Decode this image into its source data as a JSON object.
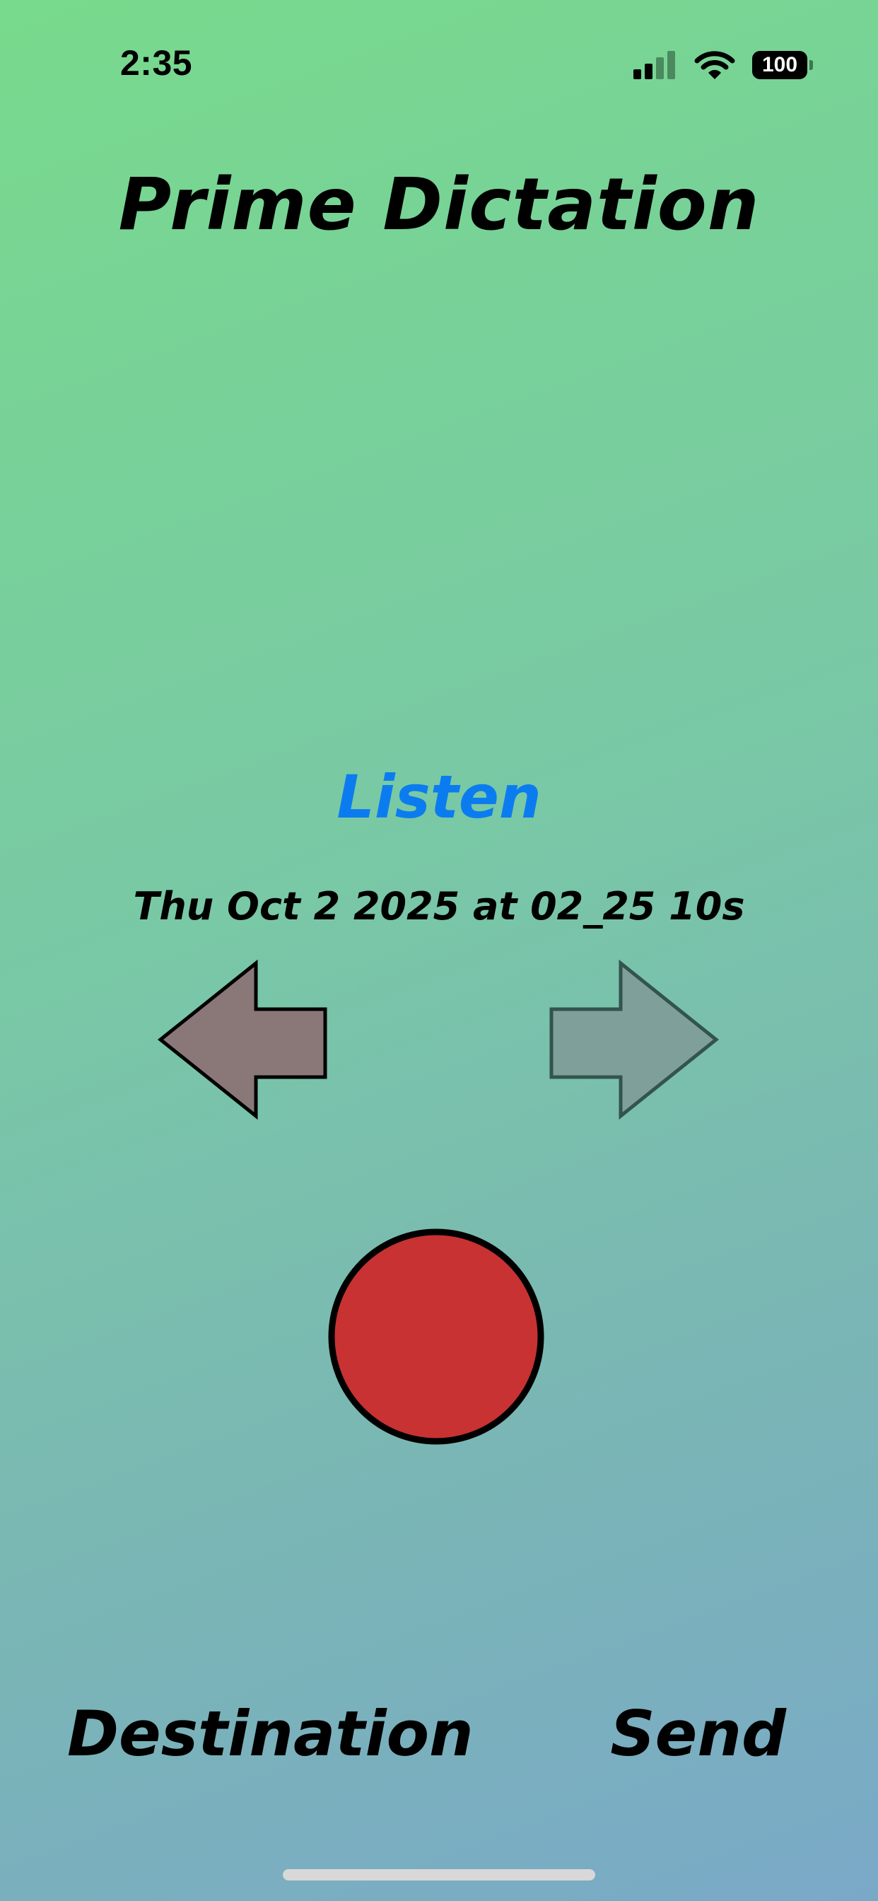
{
  "status_bar": {
    "time": "2:35",
    "battery": "100",
    "icons": [
      "cellular-signal-icon",
      "wifi-icon",
      "battery-icon"
    ]
  },
  "app": {
    "title": "Prime Dictation"
  },
  "player": {
    "listen_label": "Listen",
    "recording_name": "Thu Oct 2 2025 at 02_25 10s",
    "previous_arrow": "previous-recording-arrow-icon",
    "next_arrow": "next-recording-arrow-icon",
    "record_button": "record-button"
  },
  "bottom_bar": {
    "destination_label": "Destination",
    "send_label": "Send"
  },
  "colors": {
    "listen": "#0b7cf0",
    "record": "#c83232",
    "left_arrow": "#8a7878",
    "right_arrow": "#7fa09a",
    "background_top": "#78da8c",
    "background_bottom": "#7aa9c8"
  }
}
